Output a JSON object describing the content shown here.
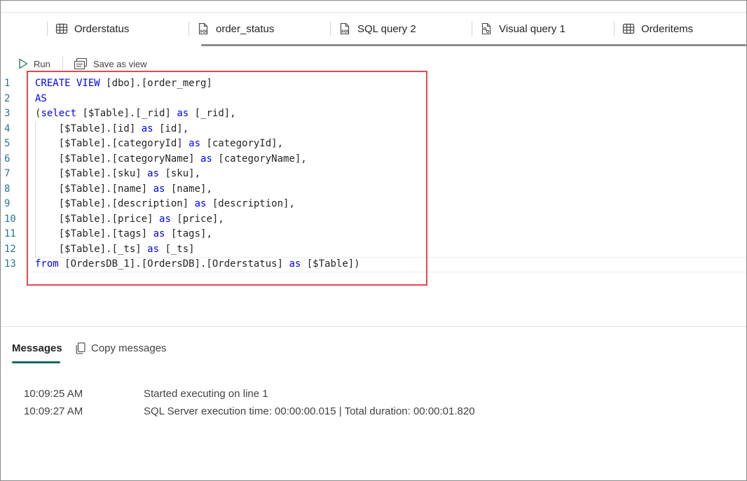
{
  "tabs": [
    {
      "label": "Orderstatus",
      "icon": "table-icon"
    },
    {
      "label": "order_status",
      "icon": "sql-file-icon"
    },
    {
      "label": "SQL query 2",
      "icon": "sql-file-icon"
    },
    {
      "label": "Visual query 1",
      "icon": "visual-query-icon"
    },
    {
      "label": "Orderitems",
      "icon": "table-icon"
    }
  ],
  "toolbar": {
    "run_label": "Run",
    "save_as_view_label": "Save as view"
  },
  "editor": {
    "line_numbers": [
      "1",
      "2",
      "3",
      "4",
      "5",
      "6",
      "7",
      "8",
      "9",
      "10",
      "11",
      "12",
      "13"
    ],
    "lines": [
      [
        {
          "t": "CREATE VIEW",
          "k": true
        },
        {
          "t": " [dbo].[order_merg]"
        }
      ],
      [
        {
          "t": "AS",
          "k": true
        }
      ],
      [
        {
          "t": "("
        },
        {
          "t": "select",
          "k": true
        },
        {
          "t": " [$Table].[_rid] "
        },
        {
          "t": "as",
          "k": true
        },
        {
          "t": " [_rid],"
        }
      ],
      [
        {
          "t": "    [$Table].[id] "
        },
        {
          "t": "as",
          "k": true
        },
        {
          "t": " [id],"
        }
      ],
      [
        {
          "t": "    [$Table].[categoryId] "
        },
        {
          "t": "as",
          "k": true
        },
        {
          "t": " [categoryId],"
        }
      ],
      [
        {
          "t": "    [$Table].[categoryName] "
        },
        {
          "t": "as",
          "k": true
        },
        {
          "t": " [categoryName],"
        }
      ],
      [
        {
          "t": "    [$Table].[sku] "
        },
        {
          "t": "as",
          "k": true
        },
        {
          "t": " [sku],"
        }
      ],
      [
        {
          "t": "    [$Table].[name] "
        },
        {
          "t": "as",
          "k": true
        },
        {
          "t": " [name],"
        }
      ],
      [
        {
          "t": "    [$Table].[description] "
        },
        {
          "t": "as",
          "k": true
        },
        {
          "t": " [description],"
        }
      ],
      [
        {
          "t": "    [$Table].[price] "
        },
        {
          "t": "as",
          "k": true
        },
        {
          "t": " [price],"
        }
      ],
      [
        {
          "t": "    [$Table].[tags] "
        },
        {
          "t": "as",
          "k": true
        },
        {
          "t": " [tags],"
        }
      ],
      [
        {
          "t": "    [$Table].[_ts] "
        },
        {
          "t": "as",
          "k": true
        },
        {
          "t": " [_ts]"
        }
      ],
      [
        {
          "t": "from",
          "k": true
        },
        {
          "t": " [OrdersDB_1].[OrdersDB].[Orderstatus] "
        },
        {
          "t": "as",
          "k": true
        },
        {
          "t": " [$Table])"
        }
      ]
    ],
    "keyword_color": "#0000ff",
    "highlight_color": "#e8464d"
  },
  "messages_pane": {
    "tab_label": "Messages",
    "copy_label": "Copy messages",
    "rows": [
      {
        "time": "10:09:25 AM",
        "text": "Started executing on line 1"
      },
      {
        "time": "10:09:27 AM",
        "text": "SQL Server execution time: 00:00:00.015 | Total duration: 00:00:01.820"
      }
    ],
    "accent_color": "#0f6b5c"
  }
}
